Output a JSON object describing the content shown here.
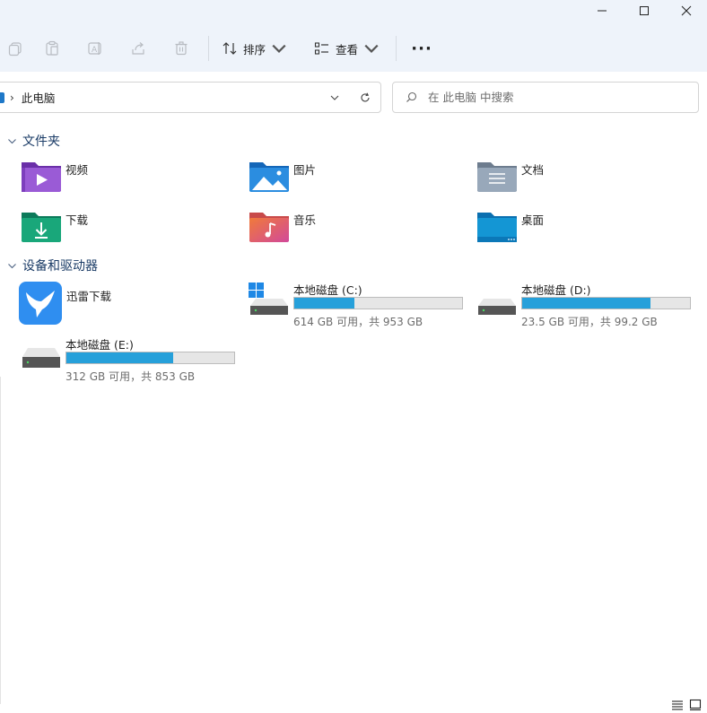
{
  "window": {
    "controls": [
      "minimize",
      "maximize",
      "close"
    ]
  },
  "toolbar": {
    "sort_label": "排序",
    "view_label": "查看",
    "more_label": "···"
  },
  "address": {
    "path": "此电脑"
  },
  "search": {
    "placeholder": "在 此电脑 中搜索"
  },
  "groups": {
    "folders_title": "文件夹",
    "devices_title": "设备和驱动器"
  },
  "folders": [
    {
      "label": "视频",
      "icon": "videos-folder-icon"
    },
    {
      "label": "图片",
      "icon": "pictures-folder-icon"
    },
    {
      "label": "文档",
      "icon": "documents-folder-icon"
    },
    {
      "label": "下载",
      "icon": "downloads-folder-icon"
    },
    {
      "label": "音乐",
      "icon": "music-folder-icon"
    },
    {
      "label": "桌面",
      "icon": "desktop-folder-icon"
    }
  ],
  "devices": {
    "app": {
      "label": "迅雷下载",
      "icon": "xunlei-app-icon"
    },
    "drives": [
      {
        "name": "本地磁盘 (C:)",
        "space": "614 GB 可用，共 953 GB",
        "used_fraction": 0.356
      },
      {
        "name": "本地磁盘 (D:)",
        "space": "23.5 GB 可用，共 99.2 GB",
        "used_fraction": 0.763
      },
      {
        "name": "本地磁盘 (E:)",
        "space": "312 GB 可用，共 853 GB",
        "used_fraction": 0.634
      }
    ]
  },
  "colors": {
    "accent": "#26a0da",
    "titlebar": "#eef3fa",
    "group_header": "#1a3b66"
  }
}
